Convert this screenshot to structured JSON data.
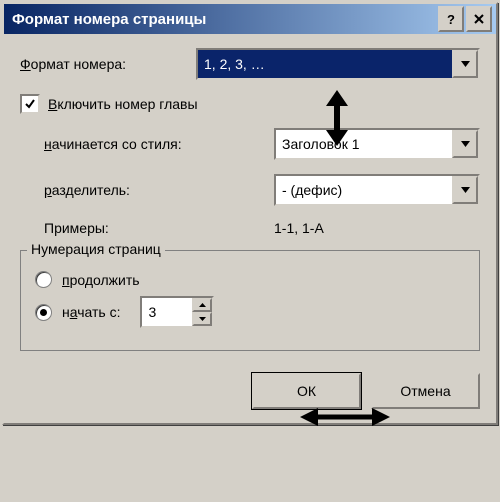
{
  "window": {
    "title": "Формат номера страницы"
  },
  "format": {
    "label_pre": "",
    "label_u": "Ф",
    "label_post": "ормат номера:",
    "value": "1, 2, 3, …"
  },
  "include_chapter": {
    "label_pre": "",
    "label_u": "В",
    "label_post": "ключить номер главы",
    "checked": true
  },
  "starts_with_style": {
    "label_pre": "",
    "label_u": "н",
    "label_post": "ачинается со стиля:",
    "value": "Заголовок 1"
  },
  "separator": {
    "label_pre": "",
    "label_u": "р",
    "label_post": "азделитель:",
    "value": "-   (дефис)"
  },
  "examples": {
    "label": "Примеры:",
    "value": "1-1, 1-A"
  },
  "numbering": {
    "legend": "Нумерация страниц",
    "continue": {
      "label_pre": "",
      "label_u": "п",
      "label_post": "родолжить"
    },
    "start_at": {
      "label_pre": "н",
      "label_u": "а",
      "label_post": "чать с:",
      "value": "3"
    }
  },
  "buttons": {
    "ok": "ОК",
    "cancel": "Отмена"
  }
}
